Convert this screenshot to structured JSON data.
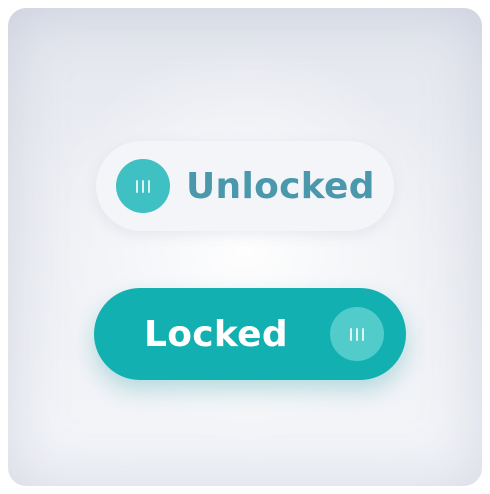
{
  "toggles": {
    "unlocked": {
      "label": "Unlocked",
      "state": "off",
      "knob_icon": "grip-lines-icon",
      "colors": {
        "track": "#f3f5f9",
        "knob": "#3fc0c2",
        "text": "#4b98ad"
      }
    },
    "locked": {
      "label": "Locked",
      "state": "on",
      "knob_icon": "grip-lines-icon",
      "colors": {
        "track": "#12b0b0",
        "knob": "#52cbcb",
        "text": "#ffffff"
      }
    }
  }
}
